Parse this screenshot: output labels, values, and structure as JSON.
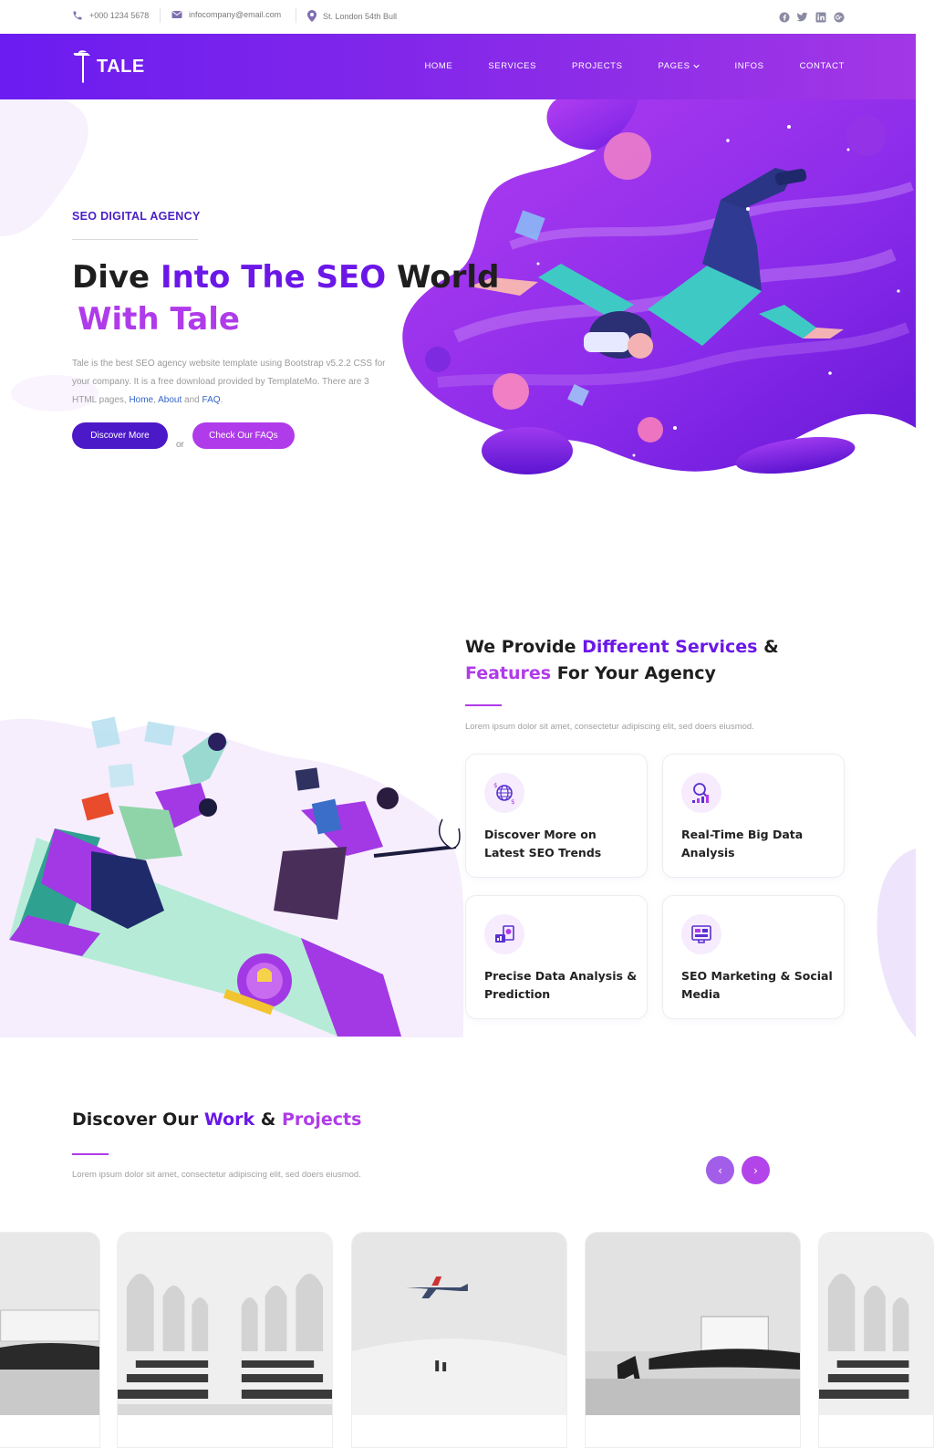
{
  "topbar": {
    "phone": "+000 1234 5678",
    "email": "infocompany@email.com",
    "address": "St. London 54th Bull",
    "social_icons": [
      "facebook-icon",
      "twitter-icon",
      "linkedin-icon",
      "google-plus-icon"
    ]
  },
  "nav": {
    "logo_text": "TALE",
    "items": [
      "HOME",
      "SERVICES",
      "PROJECTS",
      "PAGES",
      "INFOS",
      "CONTACT"
    ]
  },
  "hero": {
    "eyebrow": "SEO DIGITAL AGENCY",
    "title_part1": "Dive ",
    "title_part2": "Into The SEO",
    "title_part3": " World",
    "title_part4": "With Tale",
    "text_before": "Tale is the best SEO agency website template using Bootstrap v5.2.2 CSS for your company. It is a free download provided by TemplateMo. There are 3 HTML pages, ",
    "link1": "Home",
    "link2": "About",
    "text_and": " and ",
    "link3": "FAQ",
    "text_end": ".",
    "button1": "Discover More",
    "or_text": "or",
    "button2": "Check Our FAQs"
  },
  "services": {
    "head_part1": "We Provide ",
    "head_part2": "Different Services",
    "head_part3": " &",
    "head_part4": "Features",
    "head_part5": " For Your Agency",
    "subtitle": "Lorem ipsum dolor sit amet, consectetur adipiscing elit, sed doers eiusmod.",
    "cards": [
      {
        "title": "Discover More on Latest SEO Trends",
        "icon": "globe-dollar-icon"
      },
      {
        "title": "Real-Time Big Data Analysis",
        "icon": "search-chart-icon"
      },
      {
        "title": "Precise Data Analysis & Prediction",
        "icon": "data-analysis-icon"
      },
      {
        "title": "SEO Marketing & Social Media",
        "icon": "seo-monitor-icon"
      }
    ]
  },
  "projects": {
    "head_part1": "Discover Our ",
    "head_part2": "Work",
    "head_part3": " & ",
    "head_part4": "Projects",
    "subtitle": "Lorem ipsum dolor sit amet, consectetur adipiscing elit, sed doers eiusmod.",
    "prev": "‹",
    "next": "›"
  },
  "colors": {
    "primary": "#6b17e8",
    "accent": "#b03bea",
    "dark": "#4c19c9"
  }
}
